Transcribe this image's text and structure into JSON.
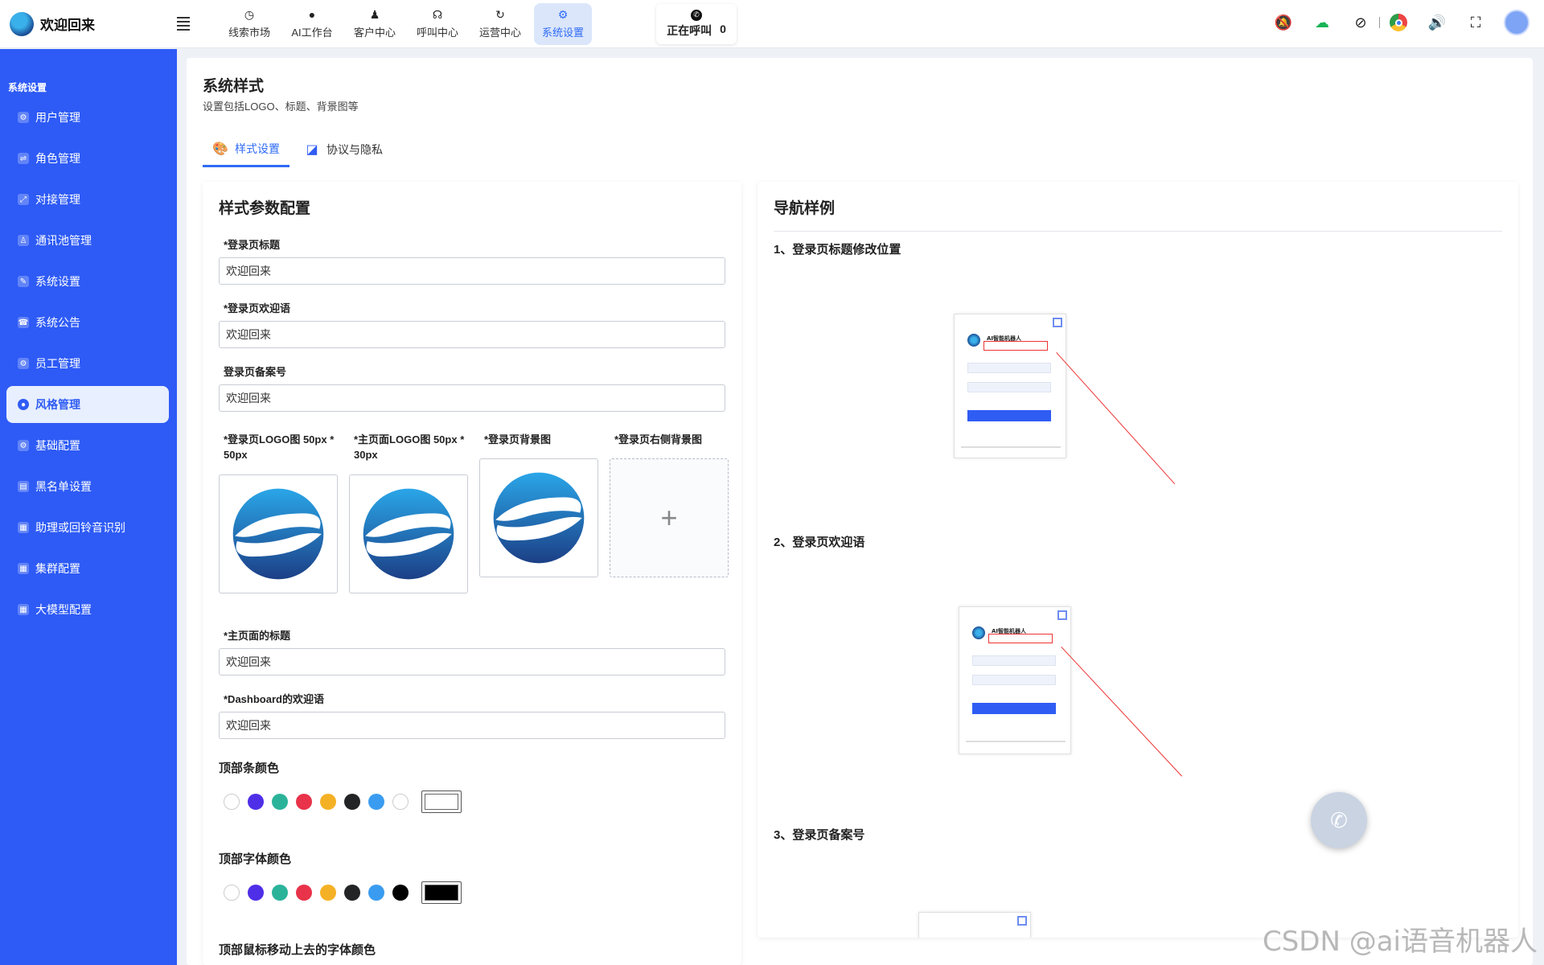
{
  "app": {
    "title": "欢迎回来"
  },
  "topnav": {
    "items": [
      {
        "label": "线索市场",
        "icon": "compass-icon"
      },
      {
        "label": "AI工作台",
        "icon": "ai-icon"
      },
      {
        "label": "客户中心",
        "icon": "users-icon"
      },
      {
        "label": "呼叫中心",
        "icon": "headset-icon"
      },
      {
        "label": "运营中心",
        "icon": "cycle-icon"
      },
      {
        "label": "系统设置",
        "icon": "gear-icon",
        "active": true
      }
    ]
  },
  "call_status": {
    "label": "正在呼叫",
    "count": "0"
  },
  "header_icons": [
    "bell-off-icon",
    "cloud-upload-icon",
    "block-icon",
    "chrome-icon",
    "volume-icon",
    "fullscreen-icon",
    "avatar"
  ],
  "sidebar": {
    "heading": "系统设置",
    "items": [
      {
        "label": "用户管理"
      },
      {
        "label": "角色管理"
      },
      {
        "label": "对接管理"
      },
      {
        "label": "通讯池管理"
      },
      {
        "label": "系统设置"
      },
      {
        "label": "系统公告"
      },
      {
        "label": "员工管理"
      },
      {
        "label": "风格管理",
        "active": true
      },
      {
        "label": "基础配置"
      },
      {
        "label": "黑名单设置"
      },
      {
        "label": "助理或回铃音识别"
      },
      {
        "label": "集群配置"
      },
      {
        "label": "大模型配置"
      }
    ]
  },
  "page": {
    "title": "系统样式",
    "desc": "设置包括LOGO、标题、背景图等",
    "tabs": [
      {
        "label": "样式设置",
        "icon": "palette-icon",
        "active": true
      },
      {
        "label": "协议与隐私",
        "icon": "document-icon"
      }
    ]
  },
  "form": {
    "title": "样式参数配置",
    "login_title": {
      "label": "*登录页标题",
      "value": "欢迎回来"
    },
    "login_welcome": {
      "label": "*登录页欢迎语",
      "value": "欢迎回来"
    },
    "login_record": {
      "label": "登录页备案号",
      "value": "欢迎回来"
    },
    "images": [
      {
        "label": "*登录页LOGO图 50px * 50px"
      },
      {
        "label": "*主页面LOGO图 50px * 30px"
      },
      {
        "label": "*登录页背景图"
      },
      {
        "label": "*登录页右侧背景图",
        "upload_symbol": "+"
      }
    ],
    "main_title": {
      "label": "*主页面的标题",
      "value": "欢迎回来"
    },
    "dashboard_welcome": {
      "label": "*Dashboard的欢迎语",
      "value": "欢迎回来"
    },
    "topbar_color": {
      "label": "顶部条颜色",
      "swatches": [
        "#ffffff",
        "#4f2ee8",
        "#2bb39a",
        "#e8334a",
        "#f5b125",
        "#222426",
        "#3a9cf0",
        "#ffffff"
      ],
      "selected": "#ffffff"
    },
    "topbar_font_color": {
      "label": "顶部字体颜色",
      "swatches": [
        "#ffffff",
        "#4f2ee8",
        "#2bb39a",
        "#e8334a",
        "#f5b125",
        "#222426",
        "#3a9cf0",
        "#000000"
      ],
      "selected": "#000000"
    },
    "hover_font_color": {
      "label": "顶部鼠标移动上去的字体颜色"
    }
  },
  "nav_sample": {
    "title": "导航样例",
    "items": [
      {
        "label": "1、登录页标题修改位置"
      },
      {
        "label": "2、登录页欢迎语"
      },
      {
        "label": "3、登录页备案号"
      }
    ]
  },
  "watermark": "CSDN @ai语音机器人"
}
